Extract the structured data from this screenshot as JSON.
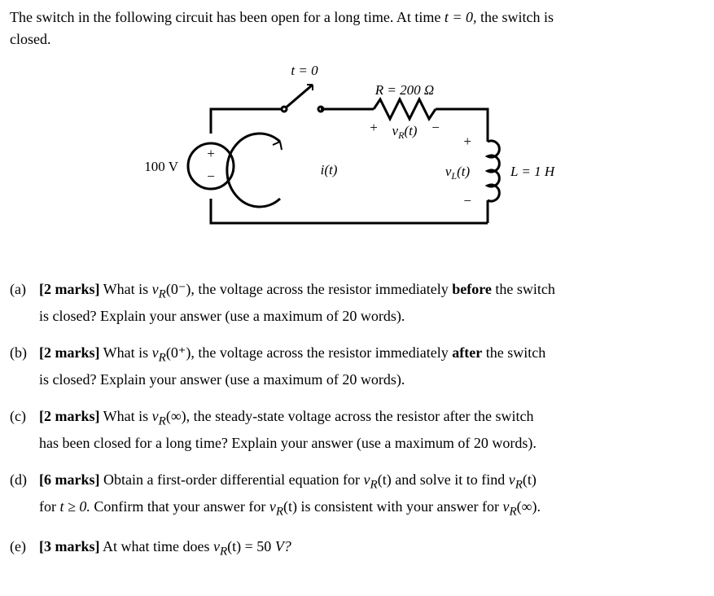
{
  "intro": {
    "l1a": "The switch in the following circuit has been open for a long time. At time ",
    "t_eq": "t = 0,",
    "l1b": " the switch is",
    "l2": "closed."
  },
  "circuit": {
    "t0": "t = 0",
    "R": "R = 200 Ω",
    "vR": "v",
    "vR_sub": "R",
    "vR_arg": "(t)",
    "vL": "v",
    "vL_sub": "L",
    "vL_arg": "(t)",
    "i": "i(t)",
    "L": "L = 1 H",
    "Vs": "100 V",
    "plus": "+",
    "minus": "−"
  },
  "q": {
    "a": {
      "tag": "(a)",
      "marks": "[2 marks]",
      "t1": " What is ",
      "sym_v": "v",
      "sym_sub": "R",
      "arg": "(0⁻),",
      "t2": " the voltage across the resistor immediately ",
      "bold": "before",
      "t3": " the switch",
      "line2": "is closed? Explain your answer (use a maximum of 20 words)."
    },
    "b": {
      "tag": "(b)",
      "marks": "[2 marks]",
      "t1": " What is ",
      "sym_v": "v",
      "sym_sub": "R",
      "arg": "(0⁺),",
      "t2": " the voltage across the resistor immediately ",
      "bold": "after",
      "t3": " the switch",
      "line2": "is closed? Explain your answer (use a maximum of 20 words)."
    },
    "c": {
      "tag": "(c)",
      "marks": "[2 marks]",
      "t1": " What is ",
      "sym_v": "v",
      "sym_sub": "R",
      "arg": "(∞),",
      "t2": " the steady-state voltage across the resistor after the switch",
      "line2": "has been closed for a long time? Explain your answer (use a maximum of 20 words)."
    },
    "d": {
      "tag": "(d)",
      "marks": "[6 marks]",
      "t1": " Obtain a first-order differential equation for ",
      "sym_v": "v",
      "sym_sub": "R",
      "arg": "(t)",
      "t2": " and solve it to find ",
      "sym_v2": "v",
      "sym_sub2": "R",
      "arg2": "(t)",
      "line2a": "for ",
      "ineq": "t ≥ 0.",
      "line2b": " Confirm that your answer for ",
      "sym_v3": "v",
      "sym_sub3": "R",
      "arg3": "(t)",
      "line2c": " is consistent with your answer for ",
      "sym_v4": "v",
      "sym_sub4": "R",
      "arg4": "(∞)."
    },
    "e": {
      "tag": "(e)",
      "marks": "[3 marks]",
      "t1": " At what time does ",
      "sym_v": "v",
      "sym_sub": "R",
      "arg": "(t)",
      "t2": " = 50 ",
      "unit": "V?"
    }
  }
}
